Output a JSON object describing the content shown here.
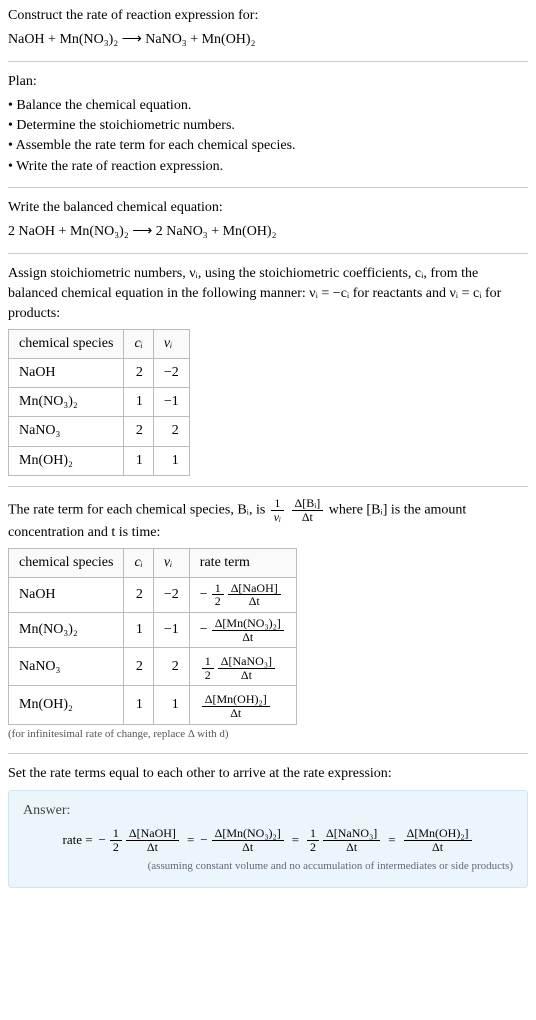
{
  "intro": {
    "title": "Construct the rate of reaction expression for:",
    "equation": "NaOH + Mn(NO₃)₂  ⟶  NaNO₃ + Mn(OH)₂"
  },
  "plan": {
    "heading": "Plan:",
    "items": [
      "Balance the chemical equation.",
      "Determine the stoichiometric numbers.",
      "Assemble the rate term for each chemical species.",
      "Write the rate of reaction expression."
    ]
  },
  "balanced": {
    "heading": "Write the balanced chemical equation:",
    "equation": "2 NaOH + Mn(NO₃)₂  ⟶  2 NaNO₃ + Mn(OH)₂"
  },
  "assign": {
    "text": "Assign stoichiometric numbers, νᵢ, using the stoichiometric coefficients, cᵢ, from the balanced chemical equation in the following manner: νᵢ = −cᵢ for reactants and νᵢ = cᵢ for products:",
    "headers": [
      "chemical species",
      "cᵢ",
      "νᵢ"
    ],
    "rows": [
      {
        "species": "NaOH",
        "c": "2",
        "v": "−2"
      },
      {
        "species": "Mn(NO₃)₂",
        "c": "1",
        "v": "−1"
      },
      {
        "species": "NaNO₃",
        "c": "2",
        "v": "2"
      },
      {
        "species": "Mn(OH)₂",
        "c": "1",
        "v": "1"
      }
    ]
  },
  "rateterm": {
    "text_a": "The rate term for each chemical species, Bᵢ, is ",
    "text_b": " where [Bᵢ] is the amount concentration and t is time:",
    "one_over_v_num": "1",
    "one_over_v_den": "νᵢ",
    "dB_num": "Δ[Bᵢ]",
    "dB_den": "Δt",
    "headers": [
      "chemical species",
      "cᵢ",
      "νᵢ",
      "rate term"
    ],
    "rows": [
      {
        "species": "NaOH",
        "c": "2",
        "v": "−2",
        "sign": "−",
        "coef_num": "1",
        "coef_den": "2",
        "d_num": "Δ[NaOH]",
        "d_den": "Δt"
      },
      {
        "species": "Mn(NO₃)₂",
        "c": "1",
        "v": "−1",
        "sign": "−",
        "coef_num": "",
        "coef_den": "",
        "d_num": "Δ[Mn(NO₃)₂]",
        "d_den": "Δt"
      },
      {
        "species": "NaNO₃",
        "c": "2",
        "v": "2",
        "sign": "",
        "coef_num": "1",
        "coef_den": "2",
        "d_num": "Δ[NaNO₃]",
        "d_den": "Δt"
      },
      {
        "species": "Mn(OH)₂",
        "c": "1",
        "v": "1",
        "sign": "",
        "coef_num": "",
        "coef_den": "",
        "d_num": "Δ[Mn(OH)₂]",
        "d_den": "Δt"
      }
    ],
    "footnote": "(for infinitesimal rate of change, replace Δ with d)"
  },
  "final": {
    "heading": "Set the rate terms equal to each other to arrive at the rate expression:"
  },
  "answer": {
    "label": "Answer:",
    "prefix": "rate =",
    "terms": [
      {
        "sign": "−",
        "coef_num": "1",
        "coef_den": "2",
        "d_num": "Δ[NaOH]",
        "d_den": "Δt"
      },
      {
        "sign": "−",
        "coef_num": "",
        "coef_den": "",
        "d_num": "Δ[Mn(NO₃)₂]",
        "d_den": "Δt"
      },
      {
        "sign": "",
        "coef_num": "1",
        "coef_den": "2",
        "d_num": "Δ[NaNO₃]",
        "d_den": "Δt"
      },
      {
        "sign": "",
        "coef_num": "",
        "coef_den": "",
        "d_num": "Δ[Mn(OH)₂]",
        "d_den": "Δt"
      }
    ],
    "eq": "=",
    "assume": "(assuming constant volume and no accumulation of intermediates or side products)"
  }
}
